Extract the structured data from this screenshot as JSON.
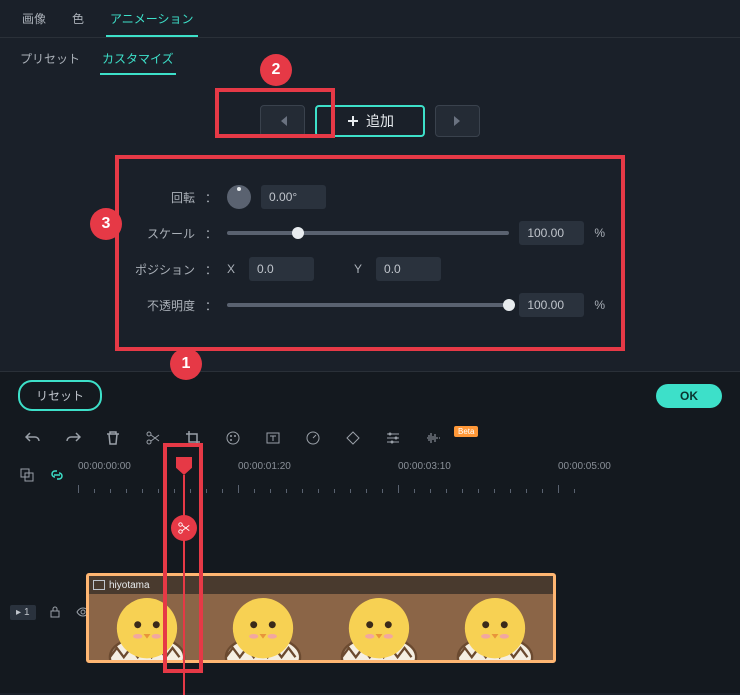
{
  "tabs": {
    "image": "画像",
    "color": "色",
    "animation": "アニメーション"
  },
  "subTabs": {
    "preset": "プリセット",
    "customize": "カスタマイズ"
  },
  "keyframe": {
    "addLabel": "追加"
  },
  "props": {
    "rotation": {
      "label": "回転",
      "value": "0.00°"
    },
    "scale": {
      "label": "スケール",
      "value": "100.00",
      "unit": "%"
    },
    "position": {
      "label": "ポジション",
      "xLabel": "X",
      "x": "0.0",
      "yLabel": "Y",
      "y": "0.0"
    },
    "opacity": {
      "label": "不透明度",
      "value": "100.00",
      "unit": "%"
    }
  },
  "buttons": {
    "reset": "リセット",
    "ok": "OK"
  },
  "betaBadge": "Beta",
  "timeline": {
    "t0": "00:00:00:00",
    "t1": "00:00:01:20",
    "t2": "00:00:03:10",
    "t3": "00:00:05:00"
  },
  "clip": {
    "name": "hiyotama"
  },
  "track": {
    "videoLabel": "1"
  },
  "callouts": {
    "one": "1",
    "two": "2",
    "three": "3"
  }
}
